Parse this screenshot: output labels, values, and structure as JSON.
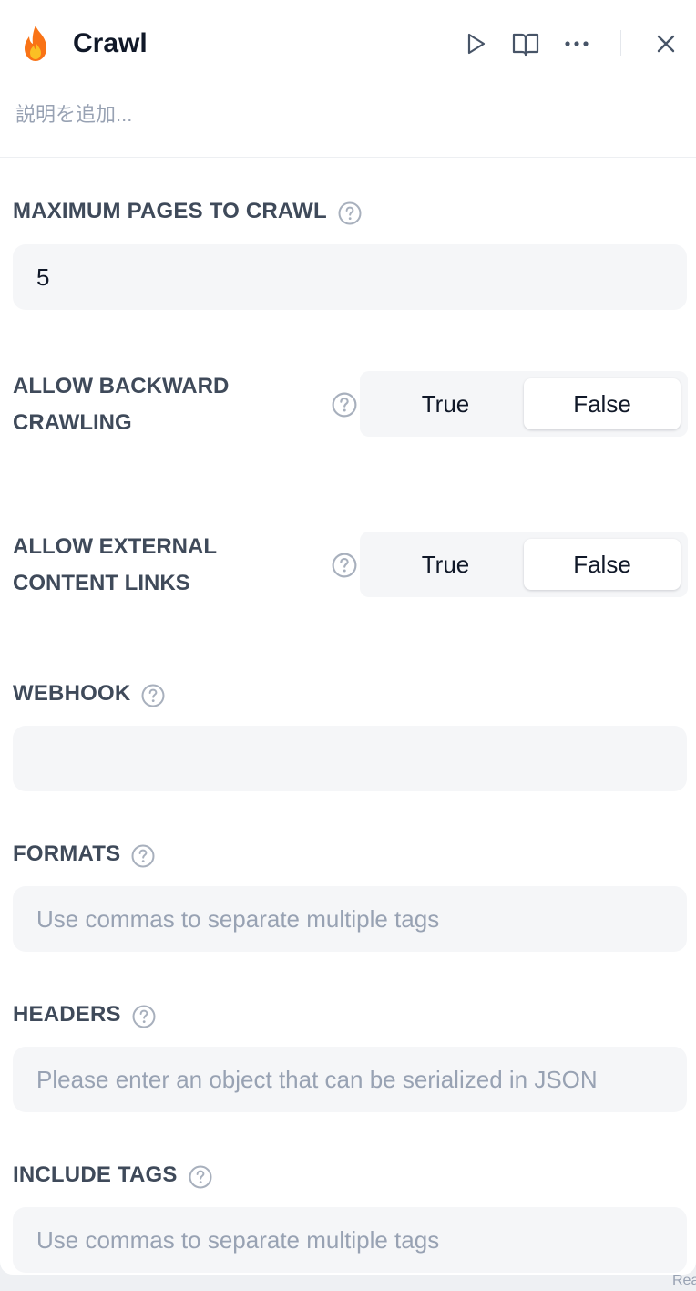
{
  "header": {
    "title": "Crawl",
    "description_placeholder": "説明を追加...",
    "actions": [
      "play-icon",
      "book-icon",
      "more-icon",
      "close-icon"
    ],
    "logo_icon": "flame-icon"
  },
  "fields": {
    "max_pages": {
      "label": "MAXIMUM PAGES TO CRAWL",
      "value": "5"
    },
    "backward": {
      "label": "ALLOW BACKWARD CRAWLING",
      "true_label": "True",
      "false_label": "False",
      "selected": "False"
    },
    "external": {
      "label": "ALLOW EXTERNAL CONTENT LINKS",
      "true_label": "True",
      "false_label": "False",
      "selected": "False"
    },
    "webhook": {
      "label": "WEBHOOK",
      "value": ""
    },
    "formats": {
      "label": "FORMATS",
      "placeholder": "Use commas to separate multiple tags"
    },
    "headers": {
      "label": "HEADERS",
      "placeholder": "Please enter an object that can be serialized in JSON"
    },
    "include_tags": {
      "label": "INCLUDE TAGS",
      "placeholder": "Use commas to separate multiple tags"
    }
  },
  "colors": {
    "label": "#3f4a5a",
    "input_bg": "#f5f6f8",
    "placeholder": "#98a2b3",
    "flame_outer": "#f97316",
    "flame_inner": "#fbbf24"
  },
  "corner_fragment": "Rea"
}
